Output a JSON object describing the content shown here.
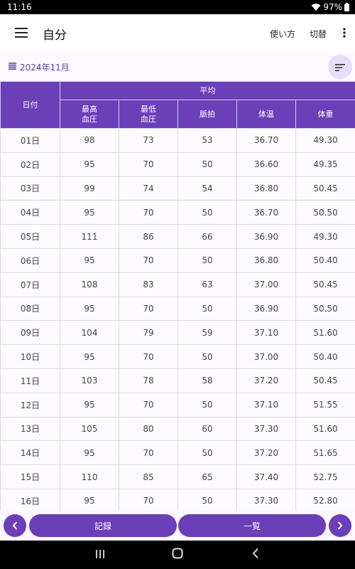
{
  "status_bar": {
    "time": "11:16",
    "battery": "97%"
  },
  "app_bar": {
    "title": "自分",
    "howto_label": "使い方",
    "switch_label": "切替"
  },
  "filter": {
    "month": "2024年11月"
  },
  "table": {
    "date_header": "日付",
    "group_header": "平均",
    "columns": [
      {
        "line1": "最高",
        "line2": "血圧"
      },
      {
        "line1": "最低",
        "line2": "血圧"
      },
      {
        "line1": "脈拍",
        "line2": ""
      },
      {
        "line1": "体温",
        "line2": ""
      },
      {
        "line1": "体重",
        "line2": ""
      }
    ],
    "rows": [
      [
        "01日",
        "98",
        "73",
        "53",
        "36.70",
        "49.30"
      ],
      [
        "02日",
        "95",
        "70",
        "50",
        "36.60",
        "49.35"
      ],
      [
        "03日",
        "99",
        "74",
        "54",
        "36.80",
        "50.45"
      ],
      [
        "04日",
        "95",
        "70",
        "50",
        "36.70",
        "50.50"
      ],
      [
        "05日",
        "111",
        "86",
        "66",
        "36.90",
        "49.30"
      ],
      [
        "06日",
        "95",
        "70",
        "50",
        "36.80",
        "50.40"
      ],
      [
        "07日",
        "108",
        "83",
        "63",
        "37.00",
        "50.45"
      ],
      [
        "08日",
        "95",
        "70",
        "50",
        "36.90",
        "50.50"
      ],
      [
        "09日",
        "104",
        "79",
        "59",
        "37.10",
        "51.60"
      ],
      [
        "10日",
        "95",
        "70",
        "50",
        "37.00",
        "50.40"
      ],
      [
        "11日",
        "103",
        "78",
        "58",
        "37.20",
        "50.45"
      ],
      [
        "12日",
        "95",
        "70",
        "50",
        "37.10",
        "51.55"
      ],
      [
        "13日",
        "105",
        "80",
        "60",
        "37.30",
        "51.60"
      ],
      [
        "14日",
        "95",
        "70",
        "50",
        "37.20",
        "51.65"
      ],
      [
        "15日",
        "110",
        "85",
        "65",
        "37.40",
        "52.75"
      ],
      [
        "16日",
        "95",
        "70",
        "50",
        "37.30",
        "52.80"
      ]
    ]
  },
  "bottom": {
    "record_label": "記録",
    "list_label": "一覧"
  },
  "icons": {
    "menu": "hamburger-menu-icon",
    "more": "more-vert-icon",
    "month": "list-icon",
    "sort": "sort-icon",
    "prev": "chevron-left-icon",
    "next": "chevron-right-icon",
    "wifi": "wifi-icon",
    "battery": "battery-icon"
  },
  "colors": {
    "primary": "#6a3fb8",
    "primary_text": "#5b3fa6",
    "surface": "#fdf7ff",
    "chip": "#e8def8"
  }
}
